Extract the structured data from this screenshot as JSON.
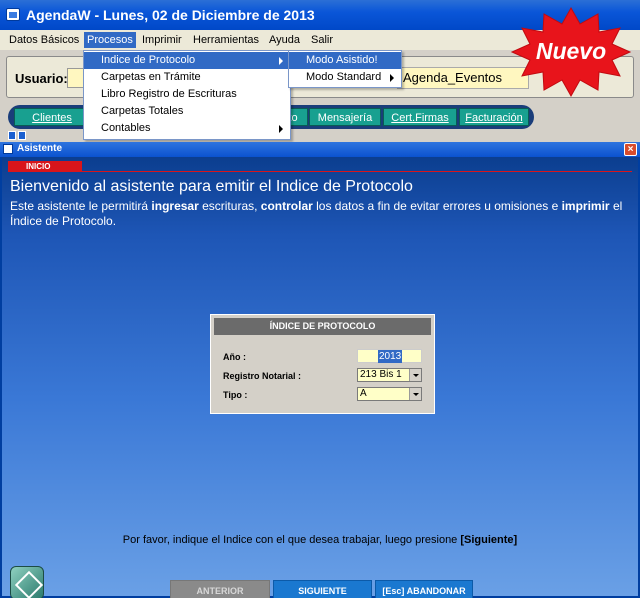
{
  "window": {
    "title": "AgendaW - Lunes, 02 de Diciembre de 2013"
  },
  "menubar": {
    "items": [
      "Datos Básicos",
      "Procesos",
      "Imprimir",
      "Herramientas",
      "Ayuda",
      "Salir"
    ]
  },
  "procesos_menu": {
    "items": [
      "Indice de Protocolo",
      "Carpetas en Trámite",
      "Libro Registro de Escrituras",
      "Carpetas Totales",
      "Contables"
    ]
  },
  "submenu": {
    "items": [
      "Modo Asistido!",
      "Modo Standard"
    ]
  },
  "userbar": {
    "label": "Usuario:",
    "event_text": "Agenda_Eventos"
  },
  "tabs": [
    "Clientes",
    "to",
    "Mensajería",
    "Cert.Firmas",
    "Facturación"
  ],
  "badge": {
    "text": "Nuevo",
    "color": "#e8141b"
  },
  "wizard": {
    "title": "Asistente",
    "step_label": "INICIO",
    "heading": "Bienvenido al asistente para emitir el Indice de Protocolo",
    "description": {
      "p1": "Este asistente le permitirá ",
      "b1": "ingresar",
      "p2": " escrituras, ",
      "b2": "controlar",
      "p3": " los datos a fin de evitar errores u omisiones e ",
      "b3": "imprimir",
      "p4": " el Índice de Protocolo."
    },
    "panel": {
      "title": "ÍNDICE DE PROTOCOLO",
      "year_label": "Año :",
      "year_value": "2013",
      "registro_label": "Registro Notarial :",
      "registro_value": "213 Bis 1",
      "tipo_label": "Tipo :",
      "tipo_value": "A"
    },
    "hint_prefix": "Por favor, indique el Indice con el que desea trabajar, luego presione ",
    "hint_bold": "[Siguiente]",
    "buttons": {
      "prev": "ANTERIOR",
      "next": "SIGUIENTE",
      "cancel": "[Esc] ABANDONAR"
    }
  }
}
